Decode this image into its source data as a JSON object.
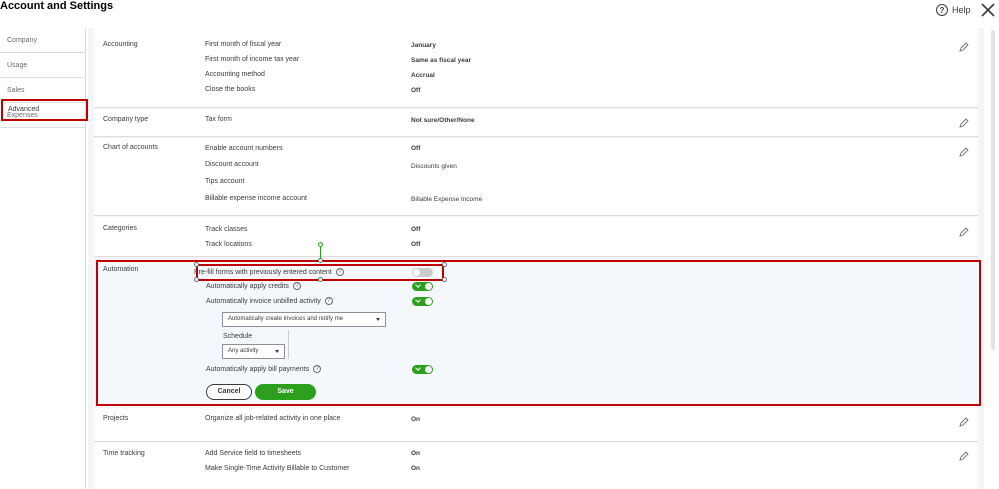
{
  "header": {
    "title": "Account and Settings",
    "help_label": "Help",
    "help_icon": "question-circle-icon",
    "close_icon": "close-icon"
  },
  "sidebar": {
    "items": [
      {
        "label": "Company"
      },
      {
        "label": "Usage"
      },
      {
        "label": "Sales"
      },
      {
        "label": "Expenses"
      },
      {
        "label": "Advanced",
        "selected": true
      }
    ]
  },
  "sections": {
    "accounting": {
      "label": "Accounting",
      "rows": [
        {
          "label": "First month of fiscal year",
          "value": "January"
        },
        {
          "label": "First month of income tax year",
          "value": "Same as fiscal year"
        },
        {
          "label": "Accounting method",
          "value": "Accrual"
        },
        {
          "label": "Close the books",
          "value": "Off"
        }
      ]
    },
    "company_type": {
      "label": "Company type",
      "rows": [
        {
          "label": "Tax form",
          "value": "Not sure/Other/None"
        }
      ]
    },
    "chart_of_accounts": {
      "label": "Chart of accounts",
      "rows": [
        {
          "label": "Enable account numbers",
          "value": "Off"
        },
        {
          "label": "Discount account",
          "value": "Discounts given"
        },
        {
          "label": "Tips account",
          "value": ""
        },
        {
          "label": "Billable expense income account",
          "value": "Billable Expense Income"
        }
      ]
    },
    "categories": {
      "label": "Categories",
      "rows": [
        {
          "label": "Track classes",
          "value": "Off"
        },
        {
          "label": "Track locations",
          "value": "Off"
        }
      ]
    },
    "automation": {
      "label": "Automation",
      "prefill_label": "Pre-fill forms with previously entered content",
      "prefill_on": false,
      "apply_credits_label": "Automatically apply credits",
      "apply_credits_on": true,
      "invoice_unbilled_label": "Automatically invoice unbilled activity",
      "invoice_unbilled_on": true,
      "invoice_option": "Automatically create invoices and notify me",
      "schedule_label": "Schedule",
      "schedule_value": "Any activity",
      "bill_payments_label": "Automatically apply bill payments",
      "bill_payments_on": true,
      "cancel_label": "Cancel",
      "save_label": "Save"
    },
    "projects": {
      "label": "Projects",
      "rows": [
        {
          "label": "Organize all job-related activity in one place",
          "value": "On"
        }
      ]
    },
    "time_tracking": {
      "label": "Time tracking",
      "rows": [
        {
          "label": "Add Service field to timesheets",
          "value": "On"
        },
        {
          "label": "Make Single-Time Activity Billable to Customer",
          "value": "On"
        }
      ]
    }
  },
  "colors": {
    "accent": "#2ca01c",
    "highlight": "#c00000",
    "panel_bg": "#f4f5f8"
  },
  "icons": {
    "edit": "pencil-icon",
    "info": "question-circle-icon",
    "dropdown": "caret-down-icon"
  }
}
